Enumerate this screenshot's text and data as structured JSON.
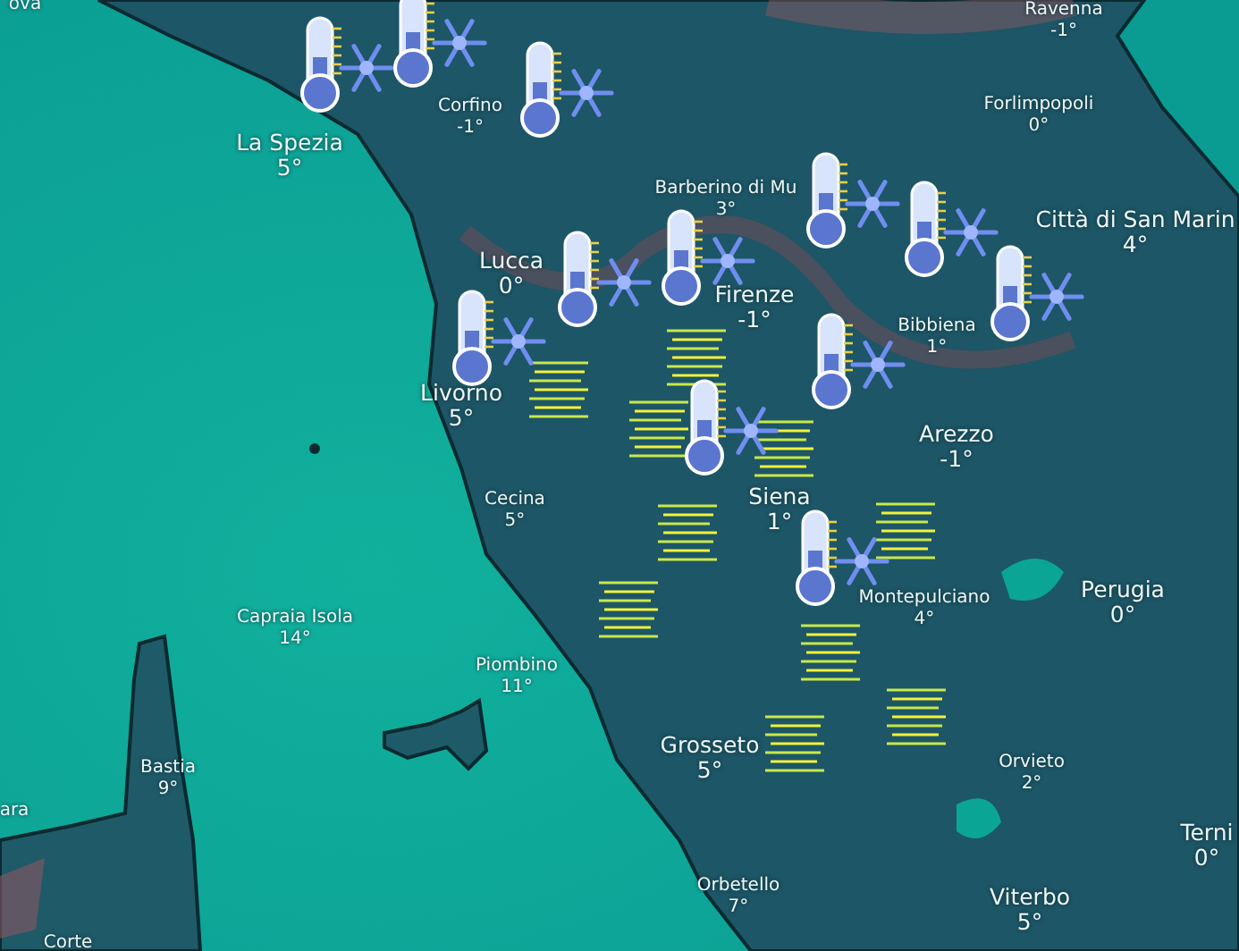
{
  "places": [
    {
      "name": "ova",
      "kind": "minor"
    },
    {
      "name": "Ravenna",
      "temp": "-1°",
      "kind": "minor"
    },
    {
      "name": "Corfino",
      "temp": "-1°",
      "kind": "minor"
    },
    {
      "name": "La Spezia",
      "temp": "5°",
      "kind": "major"
    },
    {
      "name": "Forlimpopoli",
      "temp": "0°",
      "kind": "minor"
    },
    {
      "name": "Barberino di Mu",
      "temp": "3°",
      "kind": "minor"
    },
    {
      "name": "Città di San Marin",
      "temp": "4°",
      "kind": "major"
    },
    {
      "name": "Lucca",
      "temp": "0°",
      "kind": "major"
    },
    {
      "name": "Firenze",
      "temp": "-1°",
      "kind": "major"
    },
    {
      "name": "Bibbiena",
      "temp": "1°",
      "kind": "minor"
    },
    {
      "name": "Livorno",
      "temp": "5°",
      "kind": "major"
    },
    {
      "name": "Arezzo",
      "temp": "-1°",
      "kind": "major"
    },
    {
      "name": "Siena",
      "temp": "1°",
      "kind": "major"
    },
    {
      "name": "Cecina",
      "temp": "5°",
      "kind": "minor"
    },
    {
      "name": "Montepulciano",
      "temp": "4°",
      "kind": "minor"
    },
    {
      "name": "Perugia",
      "temp": "0°",
      "kind": "major"
    },
    {
      "name": "Capraia Isola",
      "temp": "14°",
      "kind": "minor"
    },
    {
      "name": "Piombino",
      "temp": "11°",
      "kind": "minor"
    },
    {
      "name": "Grosseto",
      "temp": "5°",
      "kind": "major"
    },
    {
      "name": "Bastia",
      "temp": "9°",
      "kind": "minor"
    },
    {
      "name": "Orvieto",
      "temp": "2°",
      "kind": "minor"
    },
    {
      "name": "ara",
      "kind": "minor"
    },
    {
      "name": "Terni",
      "temp": "0°",
      "kind": "major"
    },
    {
      "name": "Orbetello",
      "temp": "7°",
      "kind": "minor"
    },
    {
      "name": "Viterbo",
      "temp": "5°",
      "kind": "major"
    },
    {
      "name": "Corte",
      "kind": "minor"
    }
  ]
}
